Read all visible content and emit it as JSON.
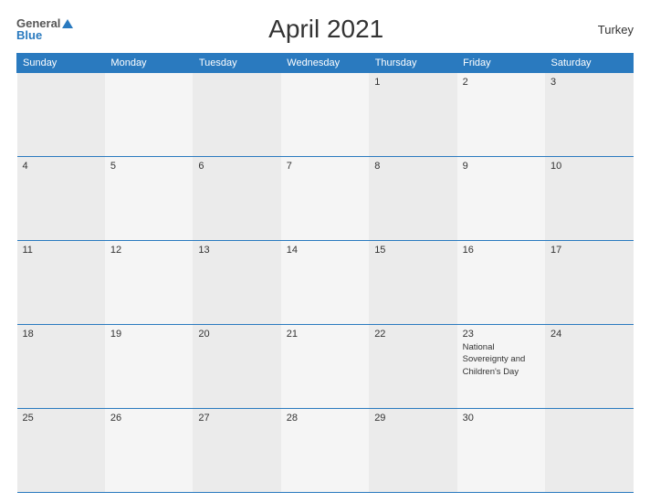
{
  "header": {
    "logo_general": "General",
    "logo_blue": "Blue",
    "title": "April 2021",
    "country": "Turkey"
  },
  "weekdays": [
    "Sunday",
    "Monday",
    "Tuesday",
    "Wednesday",
    "Thursday",
    "Friday",
    "Saturday"
  ],
  "weeks": [
    [
      {
        "day": "",
        "holiday": ""
      },
      {
        "day": "",
        "holiday": ""
      },
      {
        "day": "",
        "holiday": ""
      },
      {
        "day": "",
        "holiday": ""
      },
      {
        "day": "1",
        "holiday": ""
      },
      {
        "day": "2",
        "holiday": ""
      },
      {
        "day": "3",
        "holiday": ""
      }
    ],
    [
      {
        "day": "4",
        "holiday": ""
      },
      {
        "day": "5",
        "holiday": ""
      },
      {
        "day": "6",
        "holiday": ""
      },
      {
        "day": "7",
        "holiday": ""
      },
      {
        "day": "8",
        "holiday": ""
      },
      {
        "day": "9",
        "holiday": ""
      },
      {
        "day": "10",
        "holiday": ""
      }
    ],
    [
      {
        "day": "11",
        "holiday": ""
      },
      {
        "day": "12",
        "holiday": ""
      },
      {
        "day": "13",
        "holiday": ""
      },
      {
        "day": "14",
        "holiday": ""
      },
      {
        "day": "15",
        "holiday": ""
      },
      {
        "day": "16",
        "holiday": ""
      },
      {
        "day": "17",
        "holiday": ""
      }
    ],
    [
      {
        "day": "18",
        "holiday": ""
      },
      {
        "day": "19",
        "holiday": ""
      },
      {
        "day": "20",
        "holiday": ""
      },
      {
        "day": "21",
        "holiday": ""
      },
      {
        "day": "22",
        "holiday": ""
      },
      {
        "day": "23",
        "holiday": "National Sovereignty and Children's Day"
      },
      {
        "day": "24",
        "holiday": ""
      }
    ],
    [
      {
        "day": "25",
        "holiday": ""
      },
      {
        "day": "26",
        "holiday": ""
      },
      {
        "day": "27",
        "holiday": ""
      },
      {
        "day": "28",
        "holiday": ""
      },
      {
        "day": "29",
        "holiday": ""
      },
      {
        "day": "30",
        "holiday": ""
      },
      {
        "day": "",
        "holiday": ""
      }
    ]
  ]
}
